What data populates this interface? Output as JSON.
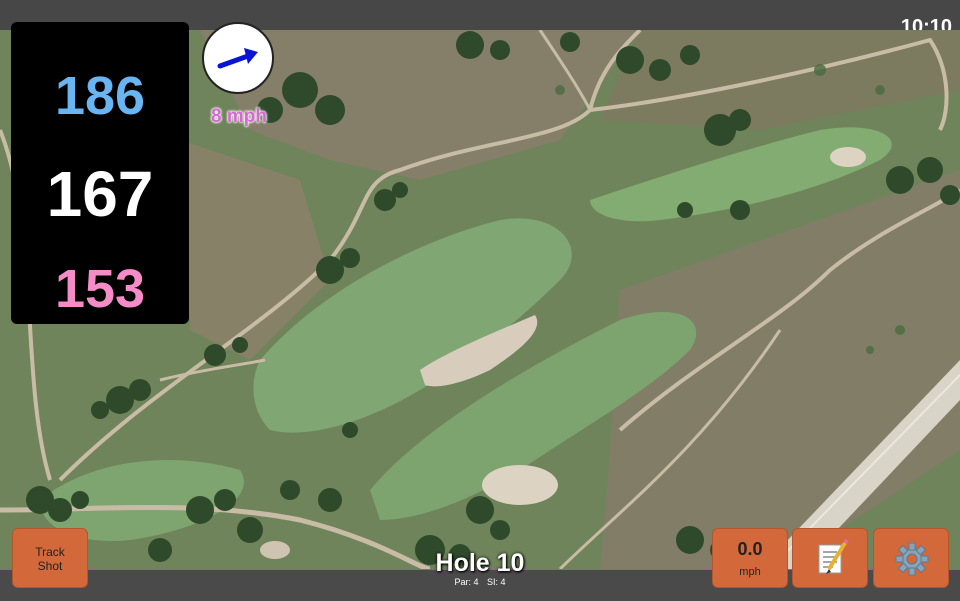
{
  "status_bar": {
    "time": "10:10"
  },
  "distances": {
    "back": "186",
    "middle": "167",
    "front": "153"
  },
  "wind": {
    "speed_label": "8 mph",
    "direction_icon": "arrow-right-up-icon"
  },
  "buttons": {
    "track_shot": "Track\nShot",
    "wind_value": "0.0",
    "wind_unit": "mph",
    "notes_icon": "memo-icon",
    "settings_icon": "gear-icon"
  },
  "hole": {
    "title": "Hole 10",
    "par": "Par: 4",
    "si": "SI: 4"
  },
  "colors": {
    "back": "#6ab4f2",
    "middle": "#ffffff",
    "front": "#f58cc8",
    "button": "#d3693b",
    "wind_text": "#d46ad0"
  }
}
